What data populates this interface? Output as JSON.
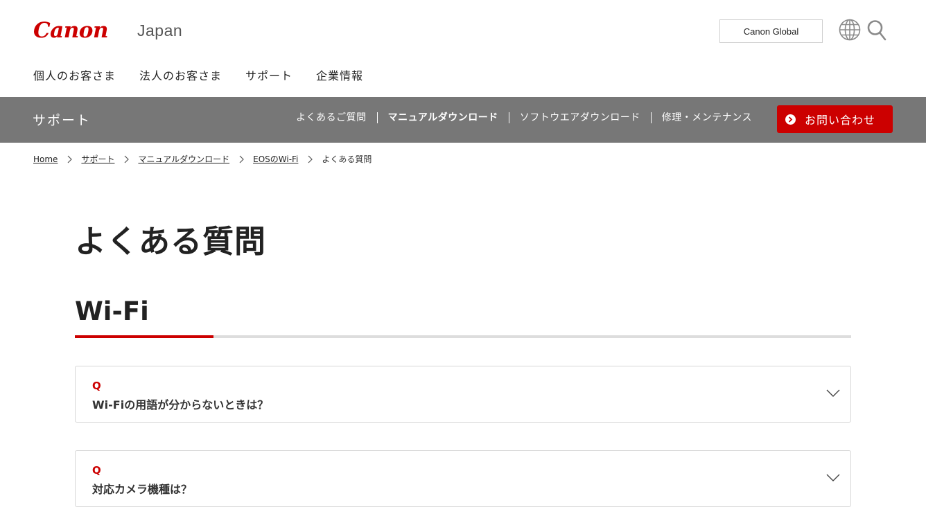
{
  "header": {
    "logo": "Canon",
    "region": "Japan",
    "global_button": "Canon Global",
    "icons": [
      "globe-icon",
      "search-icon"
    ]
  },
  "main_nav": [
    {
      "label": "個人のお客さま"
    },
    {
      "label": "法人のお客さま"
    },
    {
      "label": "サポート"
    },
    {
      "label": "企業情報"
    }
  ],
  "subbar": {
    "title": "サポート",
    "links": [
      {
        "label": "よくあるご質問",
        "active": false
      },
      {
        "label": "マニュアルダウンロード",
        "active": true
      },
      {
        "label": "ソフトウエアダウンロード",
        "active": false
      },
      {
        "label": "修理・メンテナンス",
        "active": false
      }
    ],
    "contact_button": "お問い合わせ"
  },
  "breadcrumb": [
    {
      "label": "Home",
      "link": true
    },
    {
      "label": "サポート",
      "link": true
    },
    {
      "label": "マニュアルダウンロード",
      "link": true
    },
    {
      "label": "EOSのWi-Fi",
      "link": true
    },
    {
      "label": "よくある質問",
      "link": false
    }
  ],
  "page_title": "よくある質問",
  "section": {
    "title": "Wi-Fi",
    "faqs": [
      {
        "marker": "Q",
        "question": "Wi-Fiの用語が分からないときは？"
      },
      {
        "marker": "Q",
        "question": "対応カメラ機種は？"
      }
    ]
  },
  "colors": {
    "brand_red": "#cc0000",
    "subbar_gray": "#777777",
    "border_gray": "#d6d6d6"
  }
}
